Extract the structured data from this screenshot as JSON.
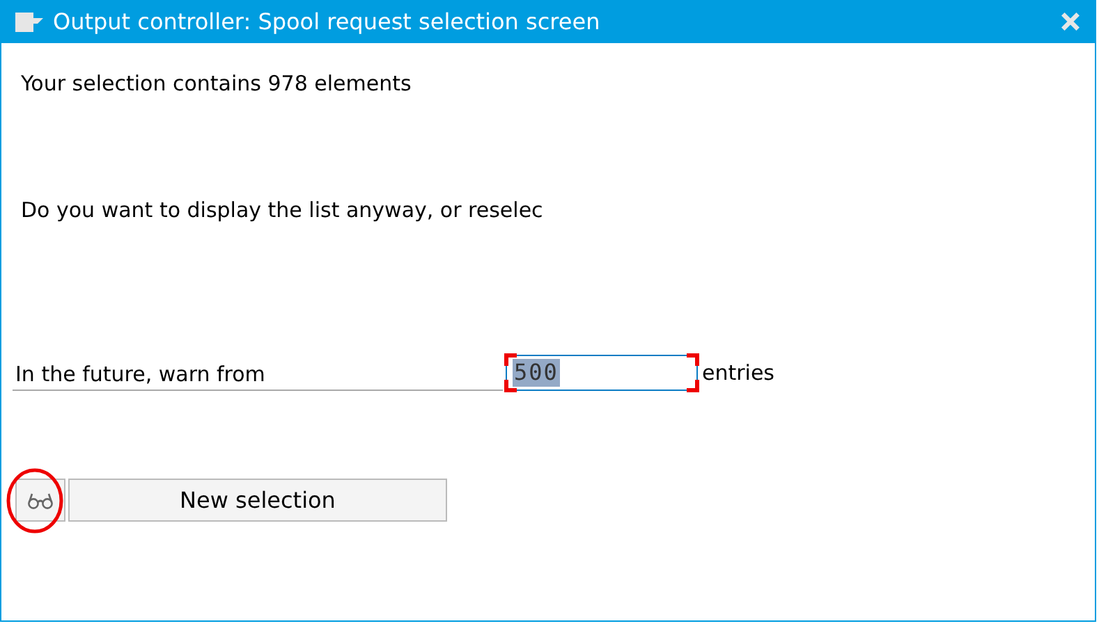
{
  "window": {
    "title": "Output controller: Spool request selection screen"
  },
  "message_lines": [
    "Your selection contains 978 elements",
    "Do you want to display the list anyway, or reselec"
  ],
  "warn_field": {
    "label": "In the future, warn from",
    "value": "500",
    "unit": "entries"
  },
  "buttons": [
    {
      "kind": "icon"
    },
    {
      "kind": "text",
      "label": "New selection"
    }
  ]
}
